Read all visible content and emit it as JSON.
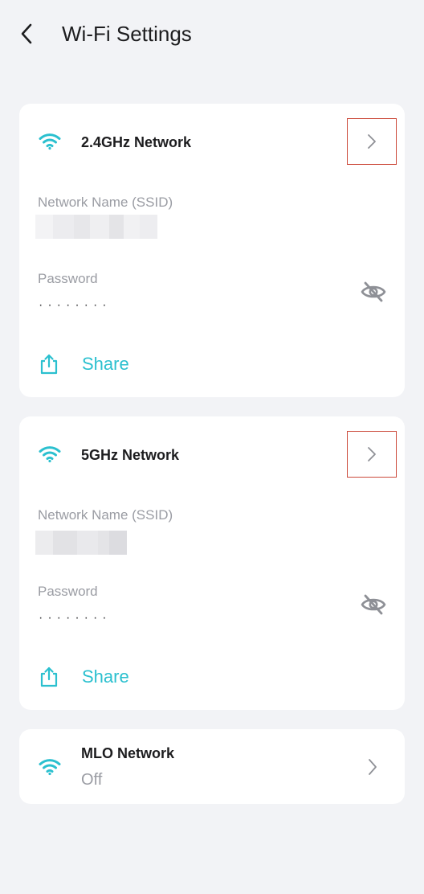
{
  "header": {
    "title": "Wi-Fi Settings"
  },
  "networks": [
    {
      "title": "2.4GHz Network",
      "ssid_label": "Network Name (SSID)",
      "ssid_value": "",
      "password_label": "Password",
      "password_mask": "········",
      "share_label": "Share"
    },
    {
      "title": "5GHz Network",
      "ssid_label": "Network Name (SSID)",
      "ssid_value": "",
      "password_label": "Password",
      "password_mask": "········",
      "share_label": "Share"
    }
  ],
  "mlo": {
    "title": "MLO Network",
    "status": "Off"
  },
  "icons": {
    "back": "chevron-left-icon",
    "wifi": "wifi-icon",
    "chevron": "chevron-right-icon",
    "eye": "eye-off-icon",
    "share": "share-icon"
  },
  "colors": {
    "accent": "#2bc0cf",
    "highlight_border": "#cc4a3b",
    "muted_text": "#9a9ca3",
    "background": "#f2f3f6",
    "card": "#ffffff"
  }
}
